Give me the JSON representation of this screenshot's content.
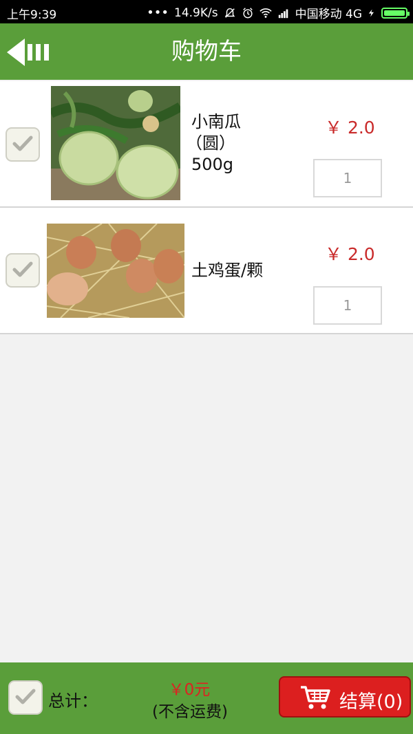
{
  "status_bar": {
    "time": "上午9:39",
    "network_speed": "14.9K/s",
    "carrier": "中国移动 4G"
  },
  "header": {
    "title": "购物车"
  },
  "cart": {
    "items": [
      {
        "name_line1": "小南瓜",
        "name_line2": "（圆）",
        "name_line3": "500g",
        "price": "￥ 2.0",
        "quantity": "1",
        "checked": true
      },
      {
        "name_line1": "土鸡蛋/颗",
        "price": "￥ 2.0",
        "quantity": "1",
        "checked": true
      }
    ]
  },
  "footer": {
    "total_label": "总计：",
    "total_amount": "￥0元",
    "total_note": "(不含运费)",
    "checkout_label": "结算(0)"
  },
  "colors": {
    "header_green": "#5a9e3a",
    "price_red": "#c92a2a",
    "checkout_red": "#dc1f1f"
  }
}
